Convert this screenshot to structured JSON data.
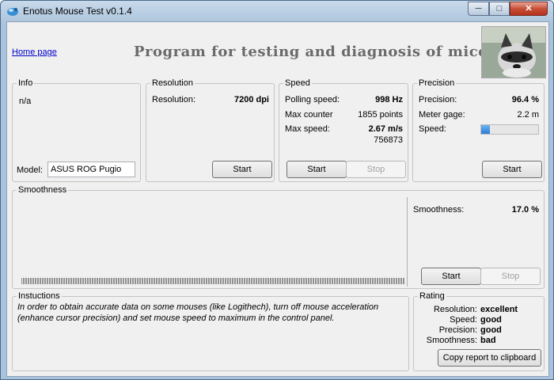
{
  "window": {
    "title": "Enotus Mouse Test v0.1.4",
    "controls": {
      "minimize": "─",
      "maximize": "□",
      "close": "✕"
    }
  },
  "header": {
    "home_link": "Home page",
    "headline": "Program for testing and diagnosis of mice"
  },
  "info": {
    "legend": "Info",
    "value": "n/a",
    "model_label": "Model:",
    "model_value": "ASUS ROG Pugio"
  },
  "resolution": {
    "legend": "Resolution",
    "label": "Resolution:",
    "value": "7200 dpi",
    "start": "Start"
  },
  "speed": {
    "legend": "Speed",
    "polling_label": "Polling speed:",
    "polling_value": "998 Hz",
    "counter_label": "Max counter",
    "counter_value": "1855 points",
    "maxspeed_label": "Max  speed:",
    "maxspeed_value": "2.67 m/s",
    "maxspeed_sub": "756873",
    "start": "Start",
    "stop": "Stop"
  },
  "precision": {
    "legend": "Precision",
    "precision_label": "Precision:",
    "precision_value": "96.4 %",
    "gage_label": "Meter gage:",
    "gage_value": "2.2 m",
    "speed_label": "Speed:",
    "speed_level": 0.15,
    "start": "Start"
  },
  "smoothness": {
    "legend": "Smoothness",
    "label": "Smoothness:",
    "value": "17.0 %",
    "start": "Start",
    "stop": "Stop"
  },
  "instructions": {
    "legend": "Instuctions",
    "text": "In order to obtain accurate data on some mouses (like Logithech), turn off mouse acceleration (enhance cursor precision) and set mouse speed to maximum in the control panel."
  },
  "rating": {
    "legend": "Rating",
    "rows": [
      {
        "label": "Resolution:",
        "value": "excellent"
      },
      {
        "label": "Speed:",
        "value": "good"
      },
      {
        "label": "Precision:",
        "value": "good"
      },
      {
        "label": "Smoothness:",
        "value": "bad"
      }
    ],
    "copy_button": "Copy report to clipboard"
  },
  "colors": {
    "accent": "#2b7ad8",
    "close": "#c75037",
    "link": "#0000cc"
  }
}
